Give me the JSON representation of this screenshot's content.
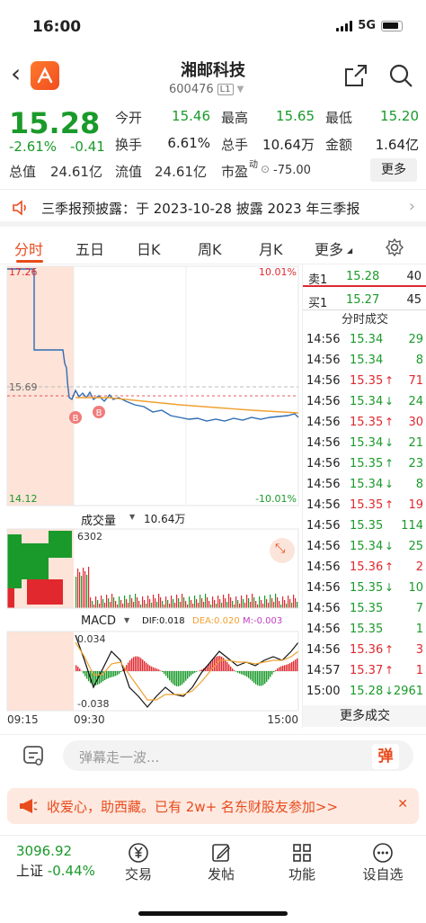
{
  "status_bar": {
    "time": "16:00",
    "network": "5G"
  },
  "header": {
    "name": "湘邮科技",
    "code": "600476",
    "level": "L1"
  },
  "quote": {
    "price": "15.28",
    "change_pct": "-2.61%",
    "change": "-0.41",
    "rows": [
      [
        {
          "label": "今开",
          "value": "15.46",
          "color": "#1a9a2a"
        },
        {
          "label": "最高",
          "value": "15.65",
          "color": "#1a9a2a"
        },
        {
          "label": "最低",
          "value": "15.20",
          "color": "#1a9a2a"
        }
      ],
      [
        {
          "label": "换手",
          "value": "6.61%",
          "color": "#222"
        },
        {
          "label": "总手",
          "value": "10.64万",
          "color": "#222"
        },
        {
          "label": "金额",
          "value": "1.64亿",
          "color": "#222"
        }
      ]
    ],
    "total_cap_label": "总值",
    "total_cap": "24.61亿",
    "float_cap_label": "流值",
    "float_cap": "24.61亿",
    "pe_label": "市盈",
    "pe_sup": "动",
    "pe": "-75.00",
    "more_label": "更多"
  },
  "notice": {
    "text": "三季报预披露：于 2023-10-28 披露 2023 年三季报"
  },
  "tabs": [
    "分时",
    "五日",
    "日K",
    "周K",
    "月K",
    "更多"
  ],
  "chart": {
    "price_high": "17.26",
    "price_mid": "15.69",
    "price_low": "14.12",
    "pct_high": "10.01%",
    "pct_low": "-10.01%",
    "volume_label": "成交量",
    "volume_value": "10.64万",
    "volume_max": "6302",
    "macd_label": "MACD",
    "dif": "DIF:0.018",
    "dea": "DEA:0.020",
    "m": "M:-0.003",
    "macd_high": "0.034",
    "macd_low": "-0.038",
    "times": [
      "09:15",
      "09:30",
      "15:00"
    ],
    "marker": "B",
    "colors": {
      "up": "#e0282e",
      "down": "#1a9a2a",
      "price_line": "#2f6db5",
      "avg_line": "#f0a030"
    }
  },
  "chart_data": {
    "type": "line",
    "x": [
      "09:15",
      "09:30",
      "15:00"
    ],
    "series": [],
    "ylim": [
      14.12,
      17.26
    ],
    "reference": 15.69
  },
  "order_book": {
    "ask": {
      "label": "卖1",
      "price": "15.28",
      "qty": "40"
    },
    "bid": {
      "label": "买1",
      "price": "15.27",
      "qty": "45"
    },
    "trades_title": "分时成交",
    "trades": [
      {
        "t": "14:56",
        "p": "15.34",
        "a": "",
        "v": "29",
        "c": "#1a9a2a"
      },
      {
        "t": "14:56",
        "p": "15.34",
        "a": "",
        "v": "8",
        "c": "#1a9a2a"
      },
      {
        "t": "14:56",
        "p": "15.35",
        "a": "↑",
        "v": "71",
        "c": "#e0282e"
      },
      {
        "t": "14:56",
        "p": "15.34",
        "a": "↓",
        "v": "24",
        "c": "#1a9a2a"
      },
      {
        "t": "14:56",
        "p": "15.35",
        "a": "↑",
        "v": "30",
        "c": "#e0282e"
      },
      {
        "t": "14:56",
        "p": "15.34",
        "a": "↓",
        "v": "21",
        "c": "#1a9a2a"
      },
      {
        "t": "14:56",
        "p": "15.35",
        "a": "↑",
        "v": "23",
        "c": "#1a9a2a"
      },
      {
        "t": "14:56",
        "p": "15.34",
        "a": "↓",
        "v": "8",
        "c": "#1a9a2a"
      },
      {
        "t": "14:56",
        "p": "15.35",
        "a": "↑",
        "v": "19",
        "c": "#e0282e"
      },
      {
        "t": "14:56",
        "p": "15.35",
        "a": "",
        "v": "114",
        "c": "#1a9a2a"
      },
      {
        "t": "14:56",
        "p": "15.34",
        "a": "↓",
        "v": "25",
        "c": "#1a9a2a"
      },
      {
        "t": "14:56",
        "p": "15.36",
        "a": "↑",
        "v": "2",
        "c": "#e0282e"
      },
      {
        "t": "14:56",
        "p": "15.35",
        "a": "↓",
        "v": "10",
        "c": "#1a9a2a"
      },
      {
        "t": "14:56",
        "p": "15.35",
        "a": "",
        "v": "7",
        "c": "#1a9a2a"
      },
      {
        "t": "14:56",
        "p": "15.35",
        "a": "",
        "v": "1",
        "c": "#1a9a2a"
      },
      {
        "t": "14:56",
        "p": "15.36",
        "a": "↑",
        "v": "3",
        "c": "#e0282e"
      },
      {
        "t": "14:57",
        "p": "15.37",
        "a": "↑",
        "v": "1",
        "c": "#e0282e"
      },
      {
        "t": "15:00",
        "p": "15.28",
        "a": "↓",
        "v": "2961",
        "c": "#1a9a2a"
      }
    ],
    "more_label": "更多成交"
  },
  "comment": {
    "placeholder": "弹幕走一波...",
    "danmu": "弹"
  },
  "promo": {
    "text": "收爱心，助西藏。已有 2w+ 名东财股友参加>>"
  },
  "index": {
    "value": "3096.92",
    "name": "上证",
    "pct": "-0.44%"
  },
  "nav": [
    "交易",
    "发帖",
    "功能",
    "设自选"
  ]
}
